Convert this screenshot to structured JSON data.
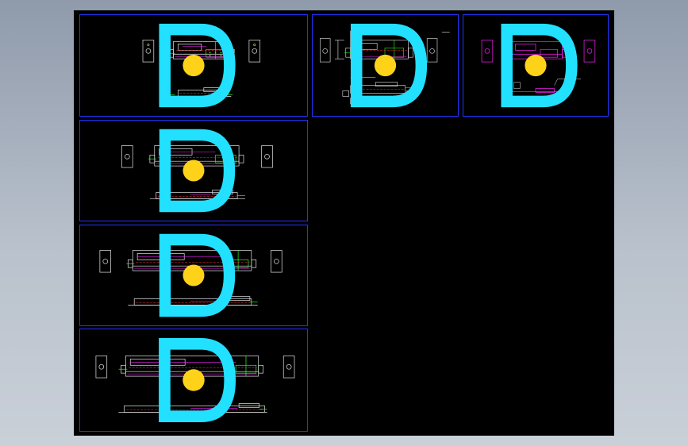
{
  "colors": {
    "background_top": "#8f9aab",
    "model_space": "#000000",
    "frame": "#2233ff",
    "outline": "#e8e8e8",
    "green": "#22ff22",
    "magenta": "#ff22ff",
    "red": "#ff3333",
    "yellow": "#ffd21a",
    "cyan": "#22e0ff"
  },
  "icons": {
    "logo": "company-logo-icon"
  },
  "sheets": [
    {
      "id": "sheet-1",
      "color_mode": "mixed",
      "title_line1": "",
      "title_line2": ""
    },
    {
      "id": "sheet-2",
      "color_mode": "dimensioned",
      "title_line1": "",
      "title_line2": ""
    },
    {
      "id": "sheet-3",
      "color_mode": "magenta",
      "title_line1": "",
      "title_line2": ""
    },
    {
      "id": "sheet-4",
      "color_mode": "mixed",
      "title_line1": "",
      "title_line2": ""
    },
    {
      "id": "sheet-5",
      "color_mode": "mixed",
      "title_line1": "",
      "title_line2": ""
    },
    {
      "id": "sheet-6",
      "color_mode": "mixed",
      "title_line1": "",
      "title_line2": ""
    }
  ]
}
